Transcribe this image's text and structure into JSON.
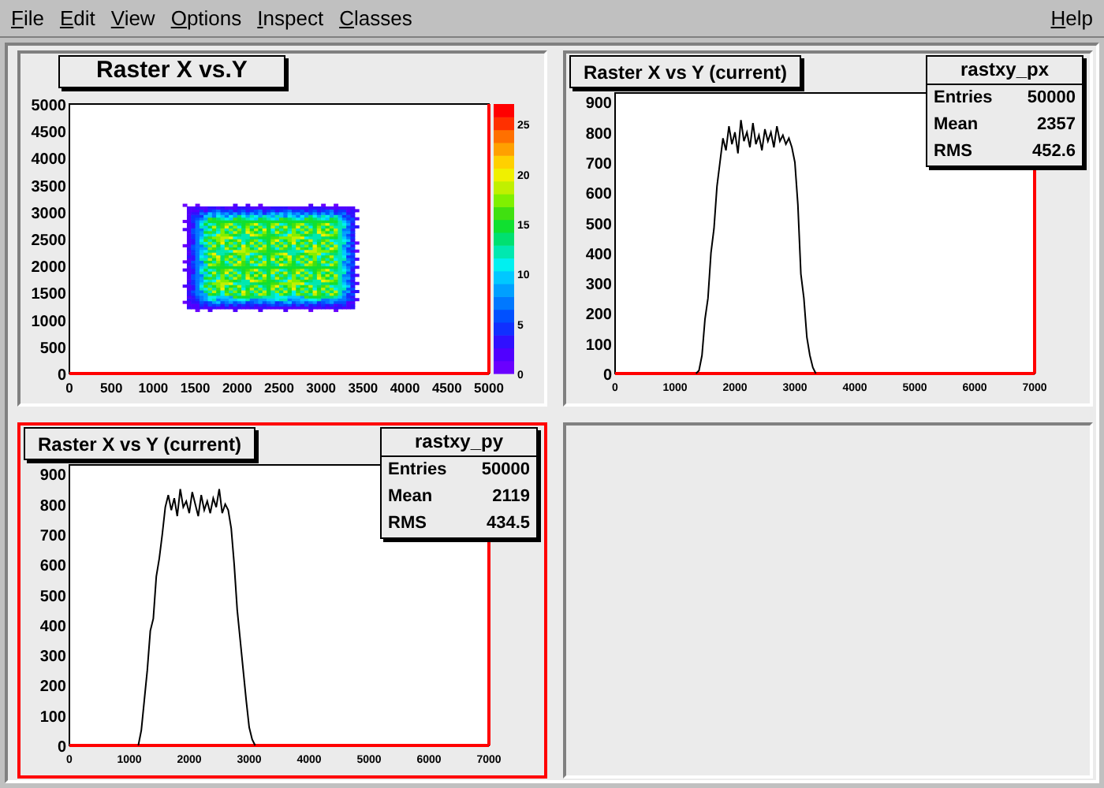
{
  "menu": [
    "File",
    "Edit",
    "View",
    "Options",
    "Inspect",
    "Classes"
  ],
  "help": "Help",
  "pads": [
    {
      "kind": "heatmap",
      "selected": false,
      "title": "Raster X vs.Y",
      "x_ticks": [
        "0",
        "500",
        "1000",
        "1500",
        "2000",
        "2500",
        "3000",
        "3500",
        "4000",
        "4500",
        "5000"
      ],
      "y_ticks": [
        "5000",
        "4500",
        "4000",
        "3500",
        "3000",
        "2500",
        "2000",
        "1500",
        "1000",
        "500",
        "0"
      ],
      "palette_ticks": [
        "25",
        "20",
        "15",
        "10",
        "5",
        "0"
      ]
    },
    {
      "kind": "histogram",
      "selected": false,
      "title": "Raster X vs Y (current)",
      "stats": {
        "rows": [
          {
            "label": "Entries",
            "value": "50000"
          },
          {
            "label": "Mean",
            "value": "2357"
          },
          {
            "label": "RMS",
            "value": "452.6"
          }
        ]
      },
      "chart_data": {
        "type": "line",
        "x": [
          1350,
          1400,
          1450,
          1500,
          1550,
          1600,
          1650,
          1700,
          1750,
          1800,
          1850,
          1900,
          1950,
          2000,
          2050,
          2100,
          2150,
          2200,
          2250,
          2300,
          2350,
          2400,
          2450,
          2500,
          2550,
          2600,
          2650,
          2700,
          2750,
          2800,
          2850,
          2900,
          2950,
          3000,
          3050,
          3100,
          3150,
          3200,
          3250,
          3300,
          3350
        ],
        "series": [
          {
            "name": "rastxy_px",
            "color": "#000000",
            "values": [
              0,
              10,
              60,
              180,
              250,
              400,
              480,
              620,
              700,
              780,
              740,
              820,
              760,
              800,
              730,
              840,
              770,
              800,
              750,
              830,
              760,
              790,
              740,
              810,
              770,
              800,
              750,
              820,
              770,
              790,
              760,
              780,
              750,
              700,
              560,
              330,
              250,
              120,
              60,
              20,
              0
            ]
          }
        ],
        "xlim": [
          0,
          7000
        ],
        "ylim": [
          0,
          930
        ],
        "xticks": [
          0,
          1000,
          2000,
          3000,
          4000,
          5000,
          6000,
          7000
        ],
        "yticks": [
          0,
          100,
          200,
          300,
          400,
          500,
          600,
          700,
          800,
          900
        ]
      }
    },
    {
      "kind": "histogram",
      "selected": true,
      "title": "Raster X vs Y (current)",
      "stats": {
        "rows": [
          {
            "label": "Entries",
            "value": "50000"
          },
          {
            "label": "Mean",
            "value": "2119"
          },
          {
            "label": "RMS",
            "value": "434.5"
          }
        ]
      },
      "chart_data": {
        "type": "line",
        "x": [
          1150,
          1200,
          1250,
          1300,
          1350,
          1400,
          1450,
          1500,
          1550,
          1600,
          1650,
          1700,
          1750,
          1800,
          1850,
          1900,
          1950,
          2000,
          2050,
          2100,
          2150,
          2200,
          2250,
          2300,
          2350,
          2400,
          2450,
          2500,
          2550,
          2600,
          2650,
          2700,
          2750,
          2800,
          2850,
          2900,
          2950,
          3000,
          3050,
          3100
        ],
        "series": [
          {
            "name": "rastxy_py",
            "color": "#000000",
            "values": [
              0,
              50,
              150,
              250,
              380,
              420,
              560,
              620,
              700,
              790,
              830,
              780,
              820,
              760,
              850,
              790,
              810,
              770,
              840,
              800,
              760,
              830,
              780,
              810,
              770,
              820,
              790,
              850,
              770,
              800,
              780,
              720,
              600,
              450,
              350,
              250,
              150,
              60,
              20,
              0
            ]
          }
        ],
        "xlim": [
          0,
          7000
        ],
        "ylim": [
          0,
          930
        ],
        "xticks": [
          0,
          1000,
          2000,
          3000,
          4000,
          5000,
          6000,
          7000
        ],
        "yticks": [
          0,
          100,
          200,
          300,
          400,
          500,
          600,
          700,
          800,
          900
        ]
      }
    },
    {
      "kind": "empty",
      "selected": false
    }
  ]
}
